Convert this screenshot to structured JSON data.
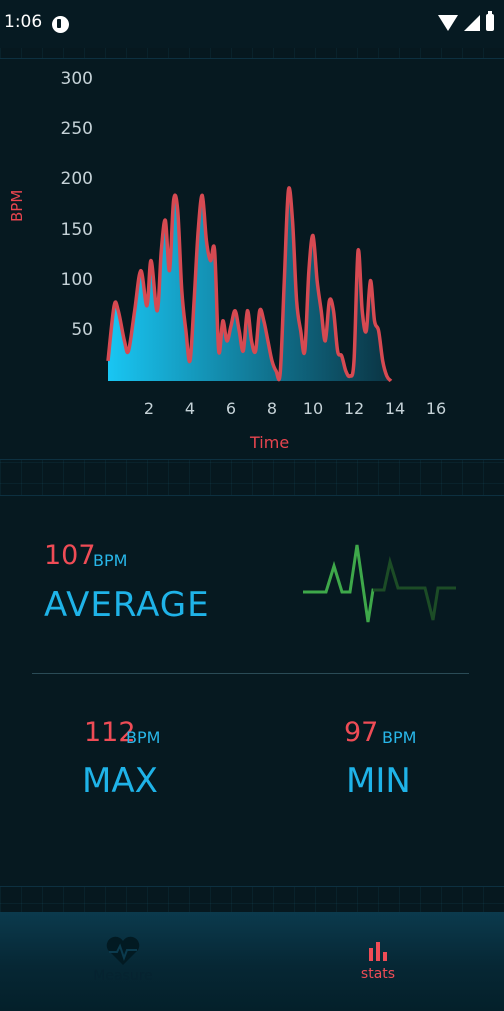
{
  "status": {
    "time": "1:06"
  },
  "chart_data": {
    "type": "area",
    "ylabel": "BPM",
    "xlabel": "Time",
    "yticks": [
      "300",
      "250",
      "200",
      "150",
      "100",
      "50"
    ],
    "xticks": [
      "2",
      "4",
      "6",
      "8",
      "10",
      "12",
      "14",
      "16"
    ],
    "ylim": [
      0,
      300
    ],
    "xlim": [
      0,
      16
    ],
    "x": [
      0,
      0.3,
      0.5,
      0.8,
      1.0,
      1.3,
      1.6,
      1.9,
      2.1,
      2.4,
      2.6,
      2.8,
      3.0,
      3.2,
      3.4,
      3.6,
      3.8,
      4.0,
      4.2,
      4.4,
      4.6,
      4.8,
      5.0,
      5.2,
      5.4,
      5.6,
      5.8,
      6.0,
      6.2,
      6.4,
      6.6,
      6.8,
      7.0,
      7.2,
      7.4,
      7.6,
      7.8,
      8.0,
      8.2,
      8.4,
      8.6,
      8.8,
      9.0,
      9.2,
      9.4,
      9.6,
      9.8,
      10.0,
      10.2,
      10.4,
      10.6,
      10.8,
      11.0,
      11.2,
      11.4,
      11.6,
      11.8,
      12.0,
      12.2,
      12.4,
      12.6,
      12.8,
      13.0,
      13.2,
      13.4,
      13.6,
      13.8
    ],
    "values": [
      20,
      75,
      70,
      40,
      30,
      70,
      110,
      75,
      120,
      70,
      130,
      160,
      110,
      180,
      170,
      90,
      50,
      20,
      80,
      150,
      185,
      140,
      120,
      130,
      30,
      60,
      40,
      55,
      70,
      50,
      30,
      70,
      40,
      30,
      70,
      60,
      40,
      20,
      10,
      8,
      100,
      190,
      160,
      80,
      50,
      30,
      110,
      145,
      100,
      70,
      40,
      80,
      70,
      30,
      25,
      10,
      5,
      20,
      130,
      70,
      50,
      100,
      60,
      50,
      20,
      5,
      0
    ],
    "line_color": "#d64a52",
    "fill_colors": [
      "#19c6f3",
      "#0a3342"
    ]
  },
  "stats": {
    "average": {
      "value": "107",
      "unit": "BPM",
      "label": "AVERAGE"
    },
    "max": {
      "value": "112",
      "unit": "BPM",
      "label": "MAX"
    },
    "min": {
      "value": "97",
      "unit": "BPM",
      "label": "MIN"
    },
    "pulse_colors": [
      "#3ea84a",
      "#1c4c26"
    ]
  },
  "nav": {
    "measure": {
      "label": "Measure",
      "icon": "heart-pulse-icon"
    },
    "stats": {
      "label": "stats",
      "icon": "bar-chart-icon"
    }
  }
}
